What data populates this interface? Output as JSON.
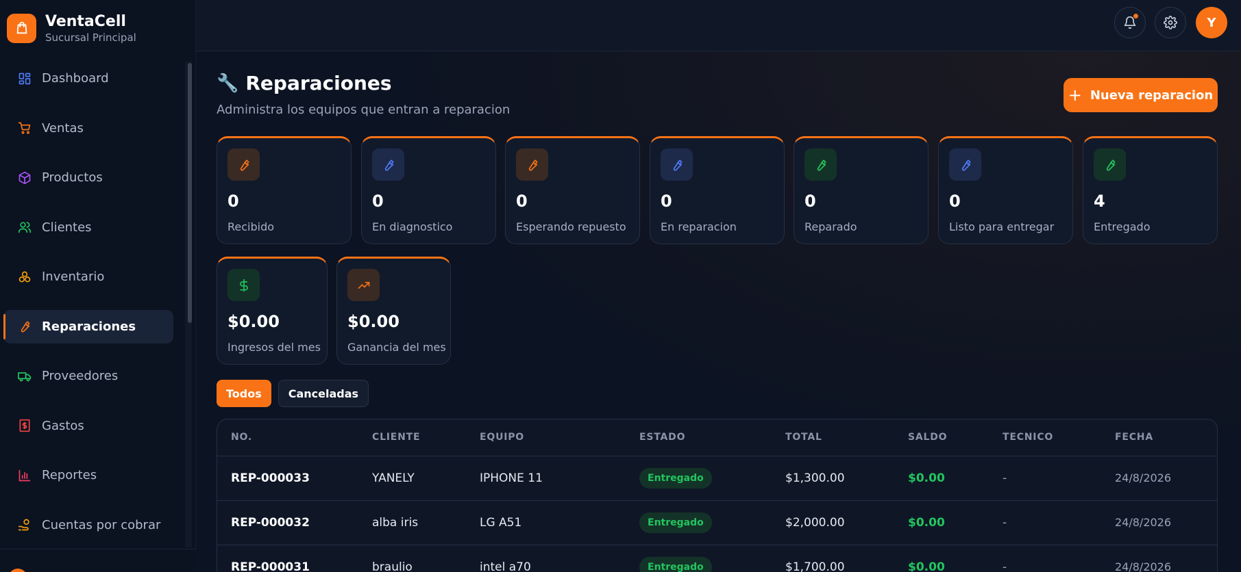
{
  "brand": {
    "name": "VentaCell",
    "subtitle": "Sucursal Principal"
  },
  "sidebar": {
    "items": [
      {
        "label": "Dashboard",
        "icon": "dashboard-icon",
        "color": "#4f7cf7"
      },
      {
        "label": "Ventas",
        "icon": "cart-icon",
        "color": "#f97316"
      },
      {
        "label": "Productos",
        "icon": "box-icon",
        "color": "#a855f7"
      },
      {
        "label": "Clientes",
        "icon": "users-icon",
        "color": "#22c55e"
      },
      {
        "label": "Inventario",
        "icon": "stack-icon",
        "color": "#f59e0b"
      },
      {
        "label": "Reparaciones",
        "icon": "wrench-icon",
        "color": "#f97316",
        "active": true
      },
      {
        "label": "Proveedores",
        "icon": "truck-icon",
        "color": "#22c55e"
      },
      {
        "label": "Gastos",
        "icon": "receipt-icon",
        "color": "#ef4444"
      },
      {
        "label": "Reportes",
        "icon": "bar-chart-icon",
        "color": "#f43f5e"
      },
      {
        "label": "Cuentas por cobrar",
        "icon": "hand-coins-icon",
        "color": "#f59e0b"
      }
    ]
  },
  "topbar": {
    "avatar_letter": "Y"
  },
  "page": {
    "title": "Reparaciones",
    "title_emoji": "🔧",
    "subtitle": "Administra los equipos que entran a reparacion",
    "new_button": "Nueva reparacion"
  },
  "stats": [
    {
      "value": "0",
      "label": "Recibido",
      "tone": "orange"
    },
    {
      "value": "0",
      "label": "En diagnostico",
      "tone": "blue"
    },
    {
      "value": "0",
      "label": "Esperando repuesto",
      "tone": "orange"
    },
    {
      "value": "0",
      "label": "En reparacion",
      "tone": "blue"
    },
    {
      "value": "0",
      "label": "Reparado",
      "tone": "green"
    },
    {
      "value": "0",
      "label": "Listo para entregar",
      "tone": "blue"
    },
    {
      "value": "4",
      "label": "Entregado",
      "tone": "green"
    }
  ],
  "money_stats": [
    {
      "value": "$0.00",
      "label": "Ingresos del mes",
      "icon": "dollar-icon",
      "tone": "green"
    },
    {
      "value": "$0.00",
      "label": "Ganancia del mes",
      "icon": "trending-up-icon",
      "tone": "orange"
    }
  ],
  "filters": {
    "all": "Todos",
    "cancelled": "Canceladas"
  },
  "table": {
    "headers": [
      "NO.",
      "CLIENTE",
      "EQUIPO",
      "ESTADO",
      "TOTAL",
      "SALDO",
      "TECNICO",
      "FECHA"
    ],
    "rows": [
      {
        "no": "REP-000033",
        "cliente": "YANELY",
        "equipo": "IPHONE 11",
        "estado": "Entregado",
        "total": "$1,300.00",
        "saldo": "$0.00",
        "tecnico": "-",
        "fecha": "24/8/2026"
      },
      {
        "no": "REP-000032",
        "cliente": "alba iris",
        "equipo": "LG A51",
        "estado": "Entregado",
        "total": "$2,000.00",
        "saldo": "$0.00",
        "tecnico": "-",
        "fecha": "24/8/2026"
      },
      {
        "no": "REP-000031",
        "cliente": "braulio",
        "equipo": "intel a70",
        "estado": "Entregado",
        "total": "$1,700.00",
        "saldo": "$0.00",
        "tecnico": "-",
        "fecha": "24/8/2026"
      }
    ]
  },
  "colors": {
    "accent": "#f97316",
    "success": "#22c55e",
    "bg": "#0c1322"
  }
}
